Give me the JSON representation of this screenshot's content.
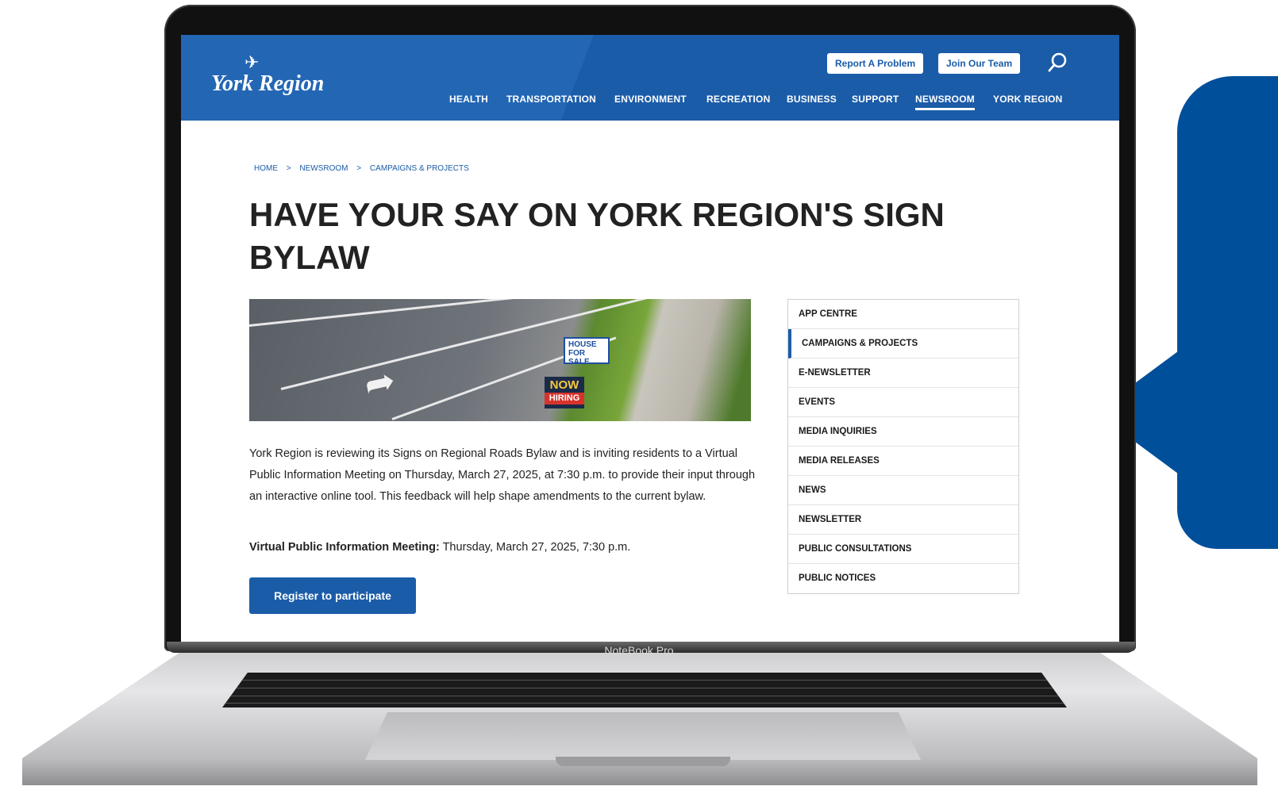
{
  "header": {
    "logo": "York Region",
    "report_btn": "Report A Problem",
    "join_btn": "Join Our Team",
    "nav": [
      "HEALTH",
      "TRANSPORTATION",
      "ENVIRONMENT",
      "RECREATION",
      "BUSINESS",
      "SUPPORT",
      "NEWSROOM",
      "YORK REGION"
    ],
    "active_nav": "NEWSROOM"
  },
  "breadcrumb": [
    "HOME",
    ">",
    "NEWSROOM",
    ">",
    "CAMPAIGNS & PROJECTS"
  ],
  "page": {
    "title": "HAVE YOUR SAY ON YORK REGION'S SIGN BYLAW",
    "hero_signs": {
      "house": "HOUSE FOR SALE",
      "now": "NOW",
      "hiring": "HIRING"
    },
    "body": "York Region is reviewing its Signs on Regional Roads Bylaw and is inviting residents to a Virtual Public Information Meeting on Thursday, March 27, 2025, at 7:30 p.m. to provide their input through an interactive online tool. This feedback will help shape amendments to the current bylaw.",
    "meeting_label": "Virtual Public Information Meeting:",
    "meeting_value": " Thursday, March 27, 2025, 7:30 p.m.",
    "register_btn": "Register to participate"
  },
  "sidebar": {
    "items": [
      "APP CENTRE",
      "CAMPAIGNS & PROJECTS",
      "E-NEWSLETTER",
      "EVENTS",
      "MEDIA INQUIRIES",
      "MEDIA RELEASES",
      "NEWS",
      "NEWSLETTER",
      "PUBLIC CONSULTATIONS",
      "PUBLIC NOTICES"
    ],
    "active": "CAMPAIGNS & PROJECTS"
  },
  "device_label": "NoteBook Pro",
  "colors": {
    "brand_blue": "#1b5ca8",
    "bubble_blue": "#004f9b"
  }
}
